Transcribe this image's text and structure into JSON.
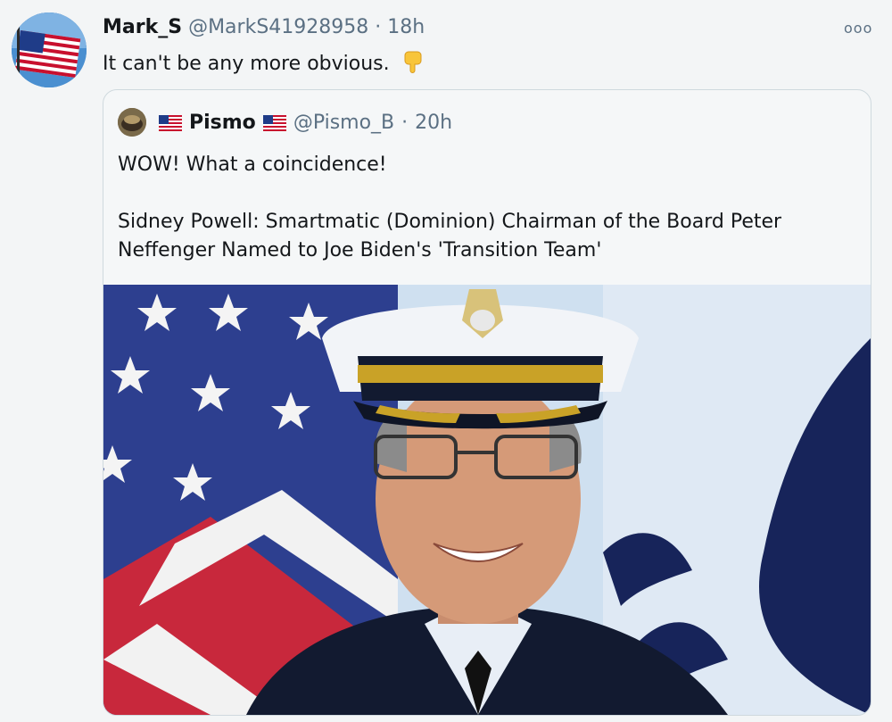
{
  "tweet": {
    "author_name": "Mark_S",
    "handle": "@MarkS41928958",
    "separator": "·",
    "time": "18h",
    "text": "It can't be any more obvious.",
    "emoji_icon": "pointing-down-hand-icon",
    "more_icon": "more-options-icon",
    "more_glyph": "ooo"
  },
  "quote": {
    "author_name": "Pismo",
    "handle": "@Pismo_B",
    "separator": "·",
    "time": "20h",
    "line1": "WOW! What a coincidence!",
    "line2": "Sidney Powell: Smartmatic (Dominion) Chairman of the Board Peter Neffenger Named to Joe Biden's 'Transition Team'"
  },
  "colors": {
    "background": "#f3f5f6",
    "muted_text": "#5b7083",
    "card_border": "#cfd9de"
  }
}
